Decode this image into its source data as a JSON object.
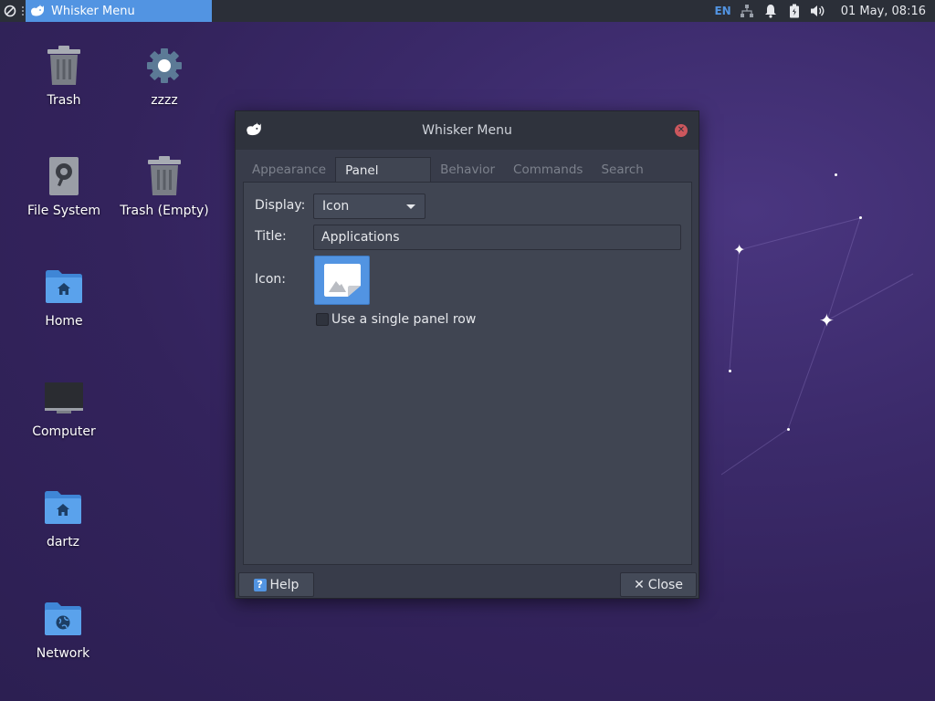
{
  "top_panel": {
    "taskbar_item": "Whisker Menu",
    "keyboard_layout": "EN",
    "clock": "01 May, 08:16",
    "icons": [
      "whisker-menu-icon",
      "network-icon",
      "notification-icon",
      "battery-icon",
      "volume-icon"
    ]
  },
  "desktop": {
    "icons": [
      {
        "label": "Trash",
        "icon": "trash-icon"
      },
      {
        "label": "zzzz",
        "icon": "settings-gear-icon"
      },
      {
        "label": "File System",
        "icon": "drive-icon"
      },
      {
        "label": "Trash (Empty)",
        "icon": "trash-icon"
      },
      {
        "label": "Home",
        "icon": "home-folder-icon"
      },
      {
        "label": "Computer",
        "icon": "computer-icon"
      },
      {
        "label": "dartz",
        "icon": "home-folder-icon"
      },
      {
        "label": "Network",
        "icon": "network-folder-icon"
      }
    ]
  },
  "dialog": {
    "title": "Whisker Menu",
    "tabs": [
      {
        "label": "Appearance",
        "active": false
      },
      {
        "label": "Panel Button",
        "active": true
      },
      {
        "label": "Behavior",
        "active": false
      },
      {
        "label": "Commands",
        "active": false
      },
      {
        "label": "Search Actions",
        "active": false
      }
    ],
    "display_label": "Display:",
    "display_value": "Icon",
    "title_label": "Title:",
    "title_value": "Applications",
    "icon_label": "Icon:",
    "single_row_label": "Use a single panel row",
    "single_row_checked": false,
    "help_label": "Help",
    "close_label": "Close"
  },
  "colors": {
    "accent": "#5294e2",
    "panel_bg": "#2b2f38",
    "dialog_bg": "#383c4a",
    "close_red": "#cc575d"
  }
}
